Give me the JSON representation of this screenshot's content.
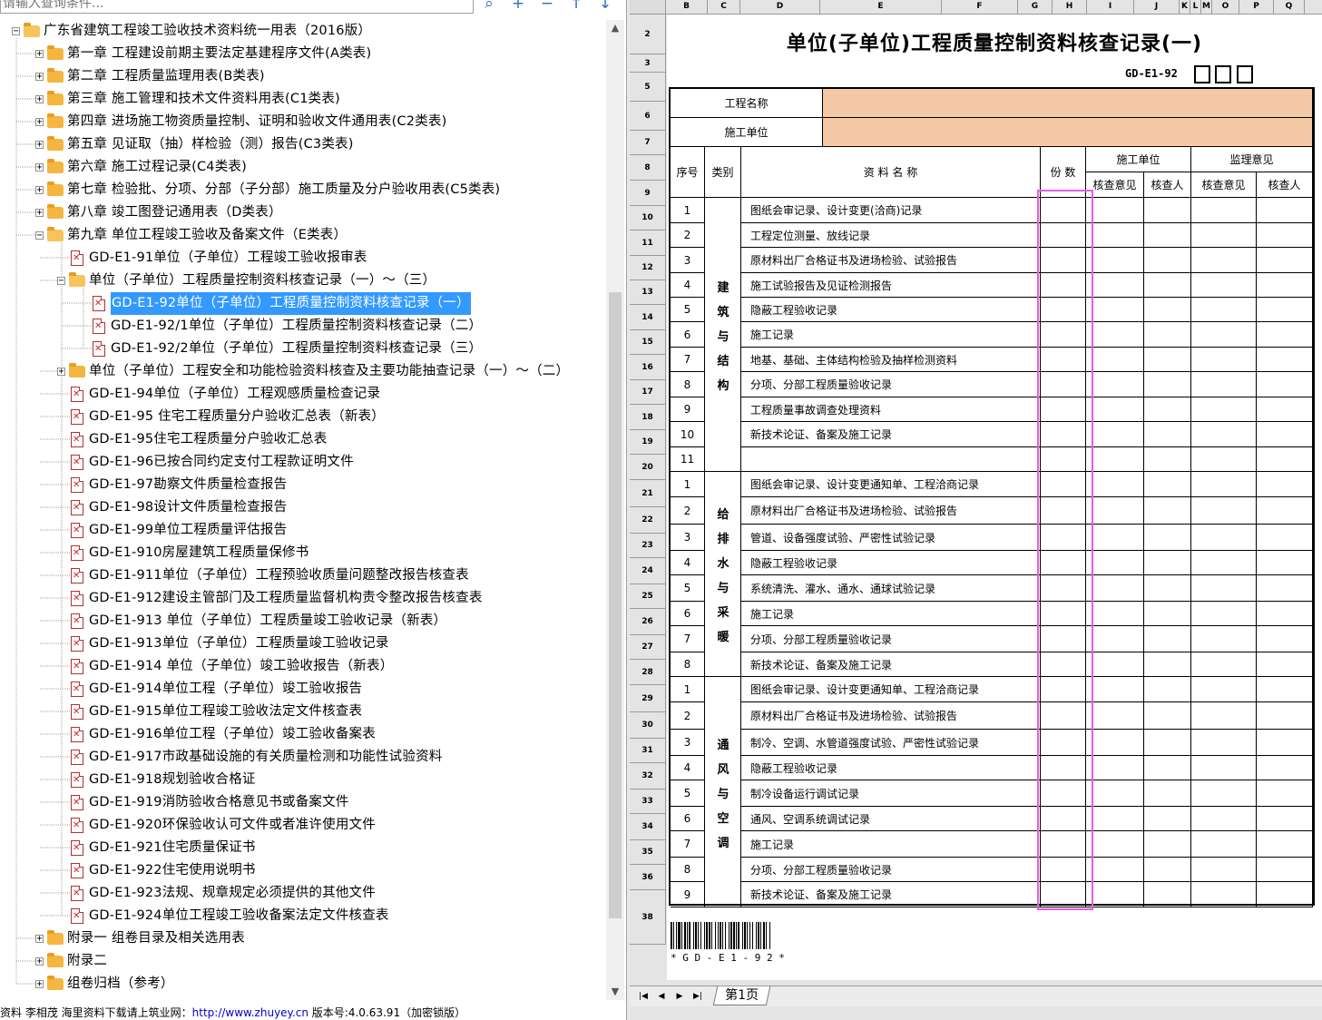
{
  "search": {
    "placeholder": "请输入查询条件..."
  },
  "toolbar_icons": [
    "search-icon",
    "plus-icon",
    "minus-icon",
    "arrow-up-icon",
    "arrow-down-icon"
  ],
  "tree": {
    "root": "广东省建筑工程竣工验收技术资料统一用表（2016版）",
    "chapters": [
      "第一章  工程建设前期主要法定基建程序文件(A类表)",
      "第二章  工程质量监理用表(B类表)",
      "第三章  施工管理和技术文件资料用表(C1类表)",
      "第四章  进场施工物资质量控制、证明和验收文件通用表(C2类表)",
      "第五章   见证取（抽）样检验（测）报告(C3类表)",
      "第六章  施工过程记录(C4类表)",
      "第七章  检验批、分项、分部（子分部）施工质量及分户验收用表(C5类表)",
      "第八章  竣工图登记通用表（D类表）",
      "第九章  单位工程竣工验收及备案文件（E类表）"
    ],
    "e91": "GD-E1-91单位（子单位）工程竣工验收报审表",
    "group1": "单位（子单位）工程质量控制资料核查记录（一）～（三）",
    "group1_items": [
      "GD-E1-92单位（子单位）工程质量控制资料核查记录（一）",
      "GD-E1-92/1单位（子单位）工程质量控制资料核查记录（二）",
      "GD-E1-92/2单位（子单位）工程质量控制资料核查记录（三）"
    ],
    "group2": "单位（子单位）工程安全和功能检验资料核查及主要功能抽查记录（一）～（二）",
    "files": [
      "GD-E1-94单位（子单位）工程观感质量检查记录",
      "GD-E1-95 住宅工程质量分户验收汇总表（新表）",
      "GD-E1-95住宅工程质量分户验收汇总表",
      "GD-E1-96已按合同约定支付工程款证明文件",
      "GD-E1-97勘察文件质量检查报告",
      "GD-E1-98设计文件质量检查报告",
      "GD-E1-99单位工程质量评估报告",
      "GD-E1-910房屋建筑工程质量保修书",
      "GD-E1-911单位（子单位）工程预验收质量问题整改报告核查表",
      "GD-E1-912建设主管部门及工程质量监督机构责令整改报告核查表",
      "GD-E1-913 单位（子单位）工程质量竣工验收记录（新表）",
      "GD-E1-913单位（子单位）工程质量竣工验收记录",
      "GD-E1-914 单位（子单位）竣工验收报告（新表）",
      "GD-E1-914单位工程（子单位）竣工验收报告",
      "GD-E1-915单位工程竣工验收法定文件核查表",
      "GD-E1-916单位工程（子单位）竣工验收备案表",
      "GD-E1-917市政基础设施的有关质量检测和功能性试验资料",
      "GD-E1-918规划验收合格证",
      "GD-E1-919消防验收合格意见书或备案文件",
      "GD-E1-920环保验收认可文件或者准许使用文件",
      "GD-E1-921住宅质量保证书",
      "GD-E1-922住宅使用说明书",
      "GD-E1-923法规、规章规定必须提供的其他文件",
      "GD-E1-924单位工程竣工验收备案法定文件核查表"
    ],
    "appendices": [
      "附录一  组卷目录及相关选用表",
      "附录二",
      "组卷归档（参考）"
    ]
  },
  "status_bar": {
    "text": "资料  李相茂  海里资料下载请上筑业网：",
    "url": "http://www.zhuyey.cn",
    "version": "  版本号:4.0.63.91（加密锁版）"
  },
  "sheet": {
    "columns": [
      "B",
      "C",
      "D",
      "E",
      "F",
      "G",
      "H",
      "I",
      "J",
      "K",
      "L",
      "M",
      "O",
      "P",
      "Q"
    ],
    "row_numbers": [
      "2",
      "3",
      "5",
      "6",
      "7",
      "8",
      "9",
      "10",
      "11",
      "12",
      "13",
      "14",
      "15",
      "16",
      "17",
      "18",
      "19",
      "20",
      "21",
      "22",
      "23",
      "24",
      "25",
      "26",
      "27",
      "28",
      "29",
      "30",
      "31",
      "32",
      "33",
      "34",
      "35",
      "36",
      "38"
    ],
    "title": "单位(子单位)工程质量控制资料核查记录(一)",
    "doc_no": "GD-E1-92",
    "labels": {
      "project_name": "工程名称",
      "construction_unit": "施工单位",
      "seq": "序号",
      "category": "类别",
      "doc_name": "资  料  名  称",
      "copies": "份 数",
      "shigong": "施工单位",
      "jianli": "监理意见",
      "check_opinion": "核查意见",
      "checker": "核查人"
    },
    "sections": [
      {
        "category": [
          "建",
          "筑",
          "与",
          "结",
          "构"
        ],
        "items": [
          {
            "no": "1",
            "name": "图纸会审记录、设计变更(洽商)记录"
          },
          {
            "no": "2",
            "name": "工程定位测量、放线记录"
          },
          {
            "no": "3",
            "name": "原材料出厂合格证书及进场检验、试验报告"
          },
          {
            "no": "4",
            "name": "施工试验报告及见证检测报告"
          },
          {
            "no": "5",
            "name": "隐蔽工程验收记录"
          },
          {
            "no": "6",
            "name": "施工记录"
          },
          {
            "no": "7",
            "name": "地基、基础、主体结构检验及抽样检测资料"
          },
          {
            "no": "8",
            "name": "分项、分部工程质量验收记录"
          },
          {
            "no": "9",
            "name": "工程质量事故调查处理资料"
          },
          {
            "no": "10",
            "name": "新技术论证、备案及施工记录"
          },
          {
            "no": "11",
            "name": ""
          }
        ]
      },
      {
        "category": [
          "给",
          "排",
          "水",
          "与",
          "采",
          "暖"
        ],
        "items": [
          {
            "no": "1",
            "name": "图纸会审记录、设计变更通知单、工程洽商记录"
          },
          {
            "no": "2",
            "name": "原材料出厂合格证书及进场检验、试验报告"
          },
          {
            "no": "3",
            "name": "管道、设备强度试验、严密性试验记录"
          },
          {
            "no": "4",
            "name": "隐蔽工程验收记录"
          },
          {
            "no": "5",
            "name": "系统清洗、灌水、通水、通球试验记录"
          },
          {
            "no": "6",
            "name": "施工记录"
          },
          {
            "no": "7",
            "name": "分项、分部工程质量验收记录"
          },
          {
            "no": "8",
            "name": "新技术论证、备案及施工记录"
          }
        ]
      },
      {
        "category": [
          "通",
          "风",
          "与",
          "空",
          "调"
        ],
        "items": [
          {
            "no": "1",
            "name": "图纸会审记录、设计变更通知单、工程洽商记录"
          },
          {
            "no": "2",
            "name": "原材料出厂合格证书及进场检验、试验报告"
          },
          {
            "no": "3",
            "name": "制冷、空调、水管道强度试验、严密性试验记录"
          },
          {
            "no": "4",
            "name": "隐蔽工程验收记录"
          },
          {
            "no": "5",
            "name": "制冷设备运行调试记录"
          },
          {
            "no": "6",
            "name": "通风、空调系统调试记录"
          },
          {
            "no": "7",
            "name": "施工记录"
          },
          {
            "no": "8",
            "name": "分项、分部工程质量验收记录"
          },
          {
            "no": "9",
            "name": "新技术论证、备案及施工记录"
          }
        ]
      }
    ],
    "barcode_text": "* G D - E 1 - 9 2 *",
    "tab_label": "第1页",
    "tab_nav": [
      "|◀",
      "◀",
      "▶",
      "▶|"
    ]
  },
  "colors": {
    "selection": "#3399ff",
    "tan": "#f6c9a6",
    "highlight": "#e060e0",
    "folder": "#f5b63f"
  }
}
